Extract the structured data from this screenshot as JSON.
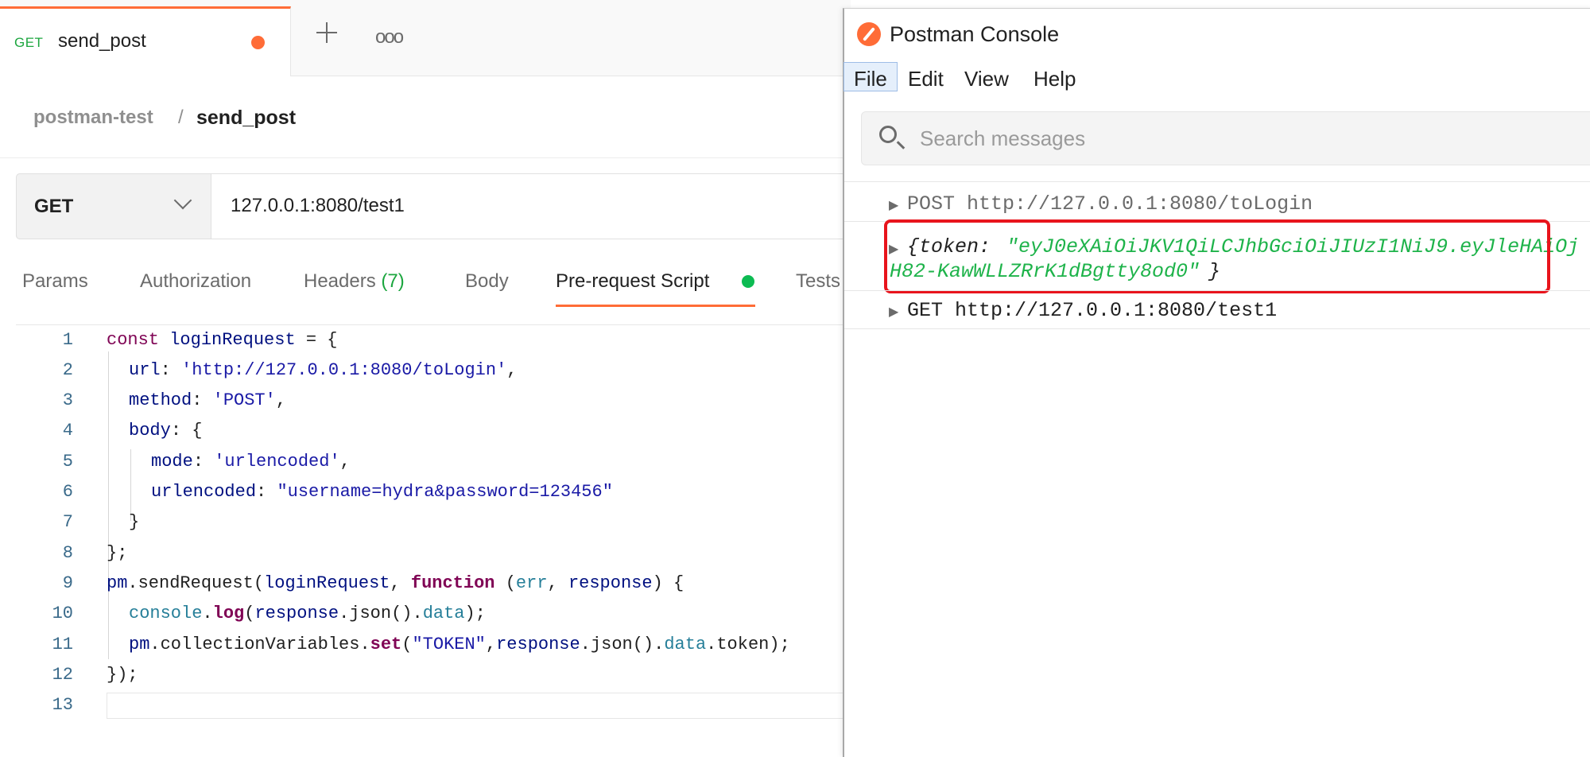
{
  "tab": {
    "method": "GET",
    "name": "send_post",
    "more": "ooo"
  },
  "breadcrumb": {
    "parent": "postman-test",
    "separator": "/",
    "current": "send_post"
  },
  "request": {
    "method": "GET",
    "url": "127.0.0.1:8080/test1"
  },
  "request_tabs": {
    "params": "Params",
    "authorization": "Authorization",
    "headers": "Headers",
    "headers_count": "(7)",
    "body": "Body",
    "prerequest": "Pre-request Script",
    "tests": "Tests"
  },
  "code": {
    "line_numbers": [
      "1",
      "2",
      "3",
      "4",
      "5",
      "6",
      "7",
      "8",
      "9",
      "10",
      "11",
      "12",
      "13"
    ],
    "l1": {
      "a": "const ",
      "b": "loginRequest",
      "c": " = {"
    },
    "l2": {
      "a": "url",
      "b": ": ",
      "c": "'http://127.0.0.1:8080/toLogin'",
      "d": ","
    },
    "l3": {
      "a": "method",
      "b": ": ",
      "c": "'POST'",
      "d": ","
    },
    "l4": {
      "a": "body",
      "b": ": {"
    },
    "l5": {
      "a": "mode",
      "b": ": ",
      "c": "'urlencoded'",
      "d": ","
    },
    "l6": {
      "a": "urlencoded",
      "b": ": ",
      "c": "\"username=hydra&password=123456\""
    },
    "l7": "}",
    "l8": "};",
    "l9": {
      "a": "pm",
      "b": ".sendRequest(",
      "c": "loginRequest",
      "d": ", ",
      "e": "function",
      "f": " (",
      "g": "err",
      "h": ", ",
      "i": "response",
      "j": ") {"
    },
    "l10": {
      "a": "console",
      "b": ".",
      "c": "log",
      "d": "(",
      "e": "response",
      "f": ".json().",
      "g": "data",
      "h": ");"
    },
    "l11": {
      "a": "pm",
      "b": ".collectionVariables.",
      "c": "set",
      "d": "(",
      "e": "\"TOKEN\"",
      "f": ",",
      "g": "response",
      "h": ".json().",
      "i": "data",
      "j": ".token);"
    },
    "l12": "});"
  },
  "console": {
    "title": "Postman Console",
    "menu": [
      "File",
      "Edit",
      "View",
      "Help"
    ],
    "search_placeholder": "Search messages",
    "logs": {
      "post": "POST http://127.0.0.1:8080/toLogin",
      "token_open": "{token: ",
      "token_part1": "\"eyJ0eXAiOiJKV1QiLCJhbGciOiJIUzI1NiJ9.eyJleHAiOj",
      "token_part2": "H82-KawWLLZRrK1dBgtty8od0\"",
      "token_close": "}",
      "get": "GET http://127.0.0.1:8080/test1"
    }
  },
  "colors": {
    "accent": "#ff6c37",
    "get_method": "#1ca63f",
    "token_string": "#1eb34a",
    "highlight": "#e8141c"
  }
}
